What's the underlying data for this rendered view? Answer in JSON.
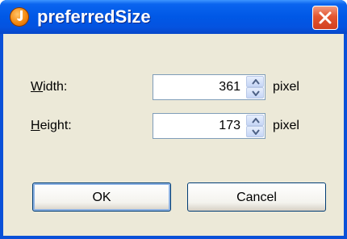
{
  "window": {
    "title": "preferredSize",
    "app_icon": "orange-circle-app-icon",
    "close_icon": "close-x-icon"
  },
  "form": {
    "width": {
      "label_ul": "W",
      "label_rest": "idth:",
      "value": "361",
      "unit": "pixel"
    },
    "height": {
      "label_ul": "H",
      "label_rest": "eight:",
      "value": "173",
      "unit": "pixel"
    }
  },
  "buttons": {
    "ok": "OK",
    "cancel": "Cancel"
  },
  "colors": {
    "titlebar": "#0058e6",
    "dialog_bg": "#ece9d8",
    "close": "#e2552f"
  }
}
